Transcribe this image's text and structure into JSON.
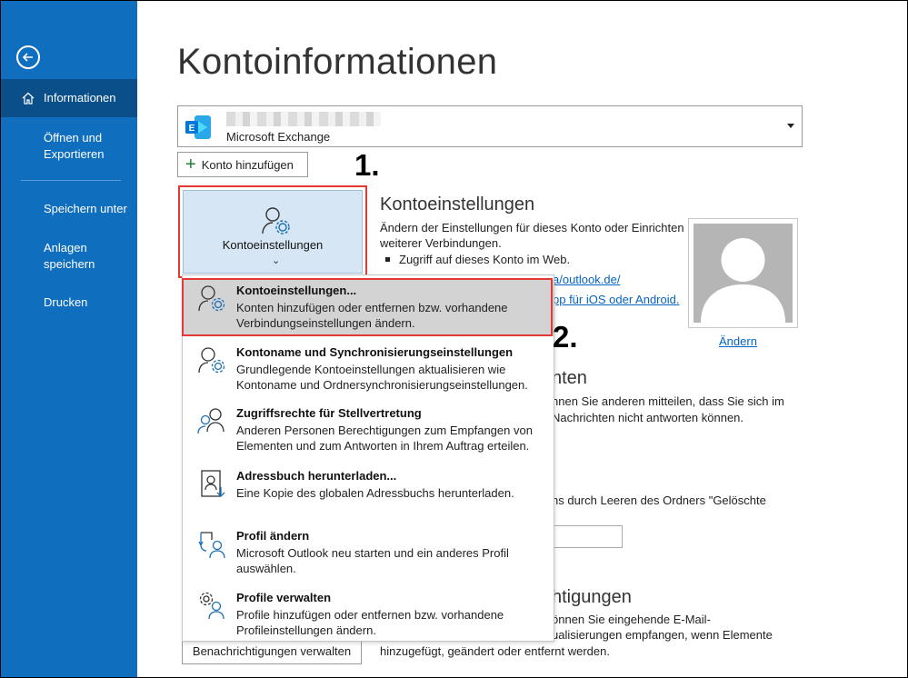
{
  "sidebar": {
    "items": [
      {
        "label": "Informationen"
      },
      {
        "label": "Öffnen und Exportieren"
      },
      {
        "label": "Speichern unter"
      },
      {
        "label": "Anlagen speichern"
      },
      {
        "label": "Drucken"
      }
    ],
    "colors": {
      "background": "#106ebe",
      "active": "#0b4f8a"
    }
  },
  "page": {
    "title": "Kontoinformationen"
  },
  "account": {
    "type": "Microsoft Exchange",
    "icon": "exchange-icon"
  },
  "buttons": {
    "add_account": "Konto hinzufügen",
    "notifications": "Benachrichtigungen verwalten"
  },
  "annotations": {
    "step1": "1.",
    "step2": "2."
  },
  "settings_tile": {
    "label": "Kontoeinstellungen",
    "chevron": "⌄"
  },
  "account_settings": {
    "heading": "Kontoeinstellungen",
    "text_line1": "Ändern der Einstellungen für dieses Konto oder Einrichten",
    "text_line2": "weiterer Verbindungen.",
    "bullet": "Zugriff auf dieses Konto im Web.",
    "link1": "a/outlook.de/",
    "link2": "pp für iOS oder Android.",
    "change_photo": "Ändern"
  },
  "background_sections": {
    "heading2": "nten",
    "text2_line1": "nnen Sie anderen mitteilen, dass Sie sich im",
    "text2_line2": "Nachrichten nicht antworten können.",
    "text3": "ns durch Leeren des Ordners \"Gelöschte",
    "heading4": "htigungen",
    "text4_line1": "önnen Sie eingehende E-Mail-",
    "text4_line2": "ualisierungen empfangen, wenn Elemente",
    "text4_line3": "hinzugefügt, geändert oder entfernt werden."
  },
  "menu": {
    "items": [
      {
        "title": "Kontoeinstellungen...",
        "desc": "Konten hinzufügen oder entfernen bzw. vorhandene Verbindungseinstellungen ändern.",
        "icon": "account-settings-icon"
      },
      {
        "title": "Kontoname und Synchronisierungseinstellungen",
        "desc": "Grundlegende Kontoeinstellungen aktualisieren wie Kontoname und Ordnersynchronisierungseinstellungen.",
        "icon": "account-sync-icon"
      },
      {
        "title": "Zugriffsrechte für Stellvertretung",
        "desc": "Anderen Personen Berechtigungen zum Empfangen von Elementen und zum Antworten in Ihrem Auftrag erteilen.",
        "icon": "delegate-access-icon"
      },
      {
        "title": "Adressbuch herunterladen...",
        "desc": "Eine Kopie des globalen Adressbuchs herunterladen.",
        "icon": "address-book-download-icon"
      },
      {
        "title": "Profil ändern",
        "desc": "Microsoft Outlook neu starten und ein anderes Profil auswählen.",
        "icon": "change-profile-icon"
      },
      {
        "title": "Profile verwalten",
        "desc": "Profile hinzufügen oder entfernen bzw. vorhandene Profileinstellungen ändern.",
        "icon": "manage-profiles-icon"
      }
    ]
  }
}
